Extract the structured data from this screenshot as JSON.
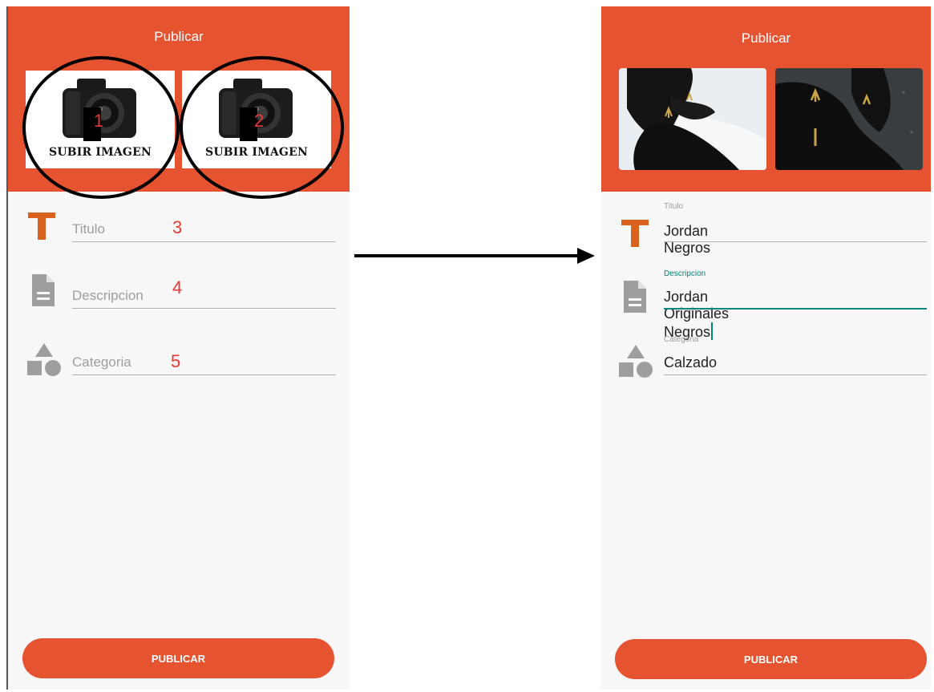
{
  "left": {
    "header_title": "Publicar",
    "uploads": [
      {
        "label": "SUBIR IMAGEN",
        "number": "1"
      },
      {
        "label": "SUBIR IMAGEN",
        "number": "2"
      }
    ],
    "fields": [
      {
        "placeholder": "Titulo",
        "number": "3",
        "icon": "title-t-icon"
      },
      {
        "placeholder": "Descripcion",
        "number": "4",
        "icon": "document-icon"
      },
      {
        "placeholder": "Categoria",
        "number": "5",
        "icon": "category-shapes-icon"
      }
    ],
    "publish_label": "PUBLICAR"
  },
  "right": {
    "header_title": "Publicar",
    "photos": [
      "black-sneaker-photo",
      "black-sneaker-photo"
    ],
    "fields": [
      {
        "label": "Titulo",
        "value": "Jordan Negros",
        "icon": "title-t-icon"
      },
      {
        "label": "Descripcion",
        "value": "Jordan Originales Negros",
        "icon": "document-icon",
        "focused": true
      },
      {
        "label": "Categoria",
        "value": "Calzado",
        "icon": "category-shapes-icon"
      }
    ],
    "publish_label": "PUBLICAR"
  },
  "colors": {
    "primary": "#e55330",
    "title_icon": "#d9631d",
    "gray_icon": "#9e9e9e",
    "focus": "#00897b",
    "annotation_red": "#e53935"
  }
}
